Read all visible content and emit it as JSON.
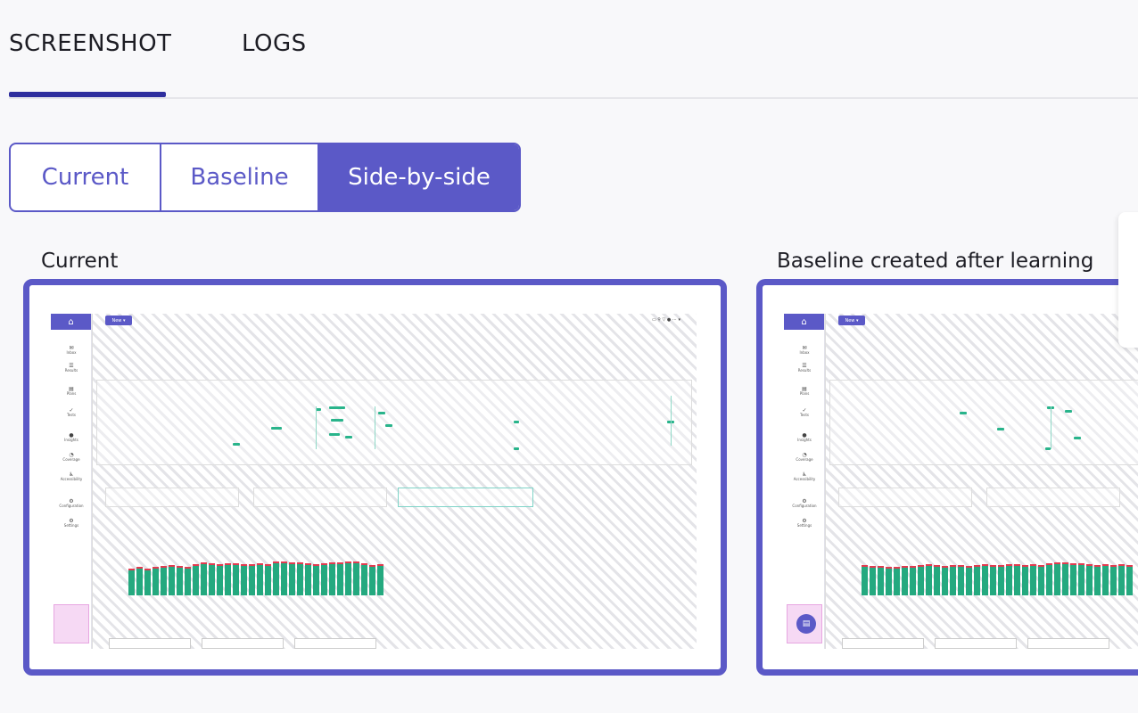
{
  "tabs": {
    "screenshot": "SCREENSHOT",
    "logs": "LOGS"
  },
  "view_toggle": {
    "current": "Current",
    "baseline": "Baseline",
    "side_by_side": "Side-by-side",
    "selected": "Side-by-side"
  },
  "panels": {
    "current_label": "Current",
    "baseline_label": "Baseline created after learning"
  },
  "colors": {
    "accent": "#5b59c7",
    "tab_underline": "#2f2f9e",
    "bar_green": "#24a97f",
    "bar_red": "#e23b50"
  },
  "thumb": {
    "new_button": "New ▾",
    "sidebar": [
      "Home",
      "Inbox",
      "Results",
      "Plans",
      "Tests",
      "Insights",
      "Coverage",
      "Accessibility",
      "Configuration",
      "Settings"
    ]
  }
}
